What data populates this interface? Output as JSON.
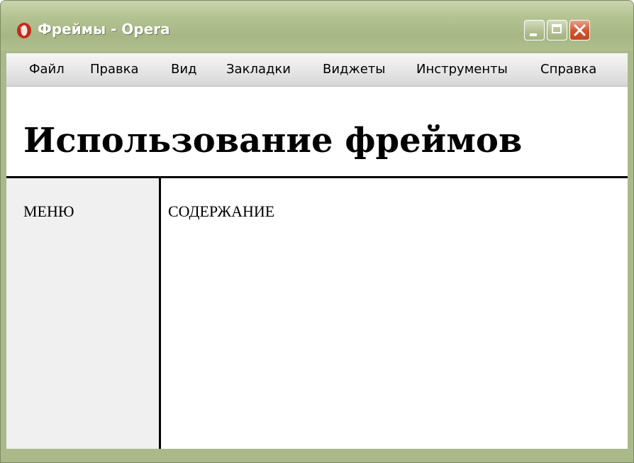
{
  "window": {
    "title": "Фреймы - Opera",
    "app_icon": "opera-icon",
    "controls": {
      "minimize_icon": "minimize-icon",
      "maximize_icon": "maximize-icon",
      "close_icon": "close-icon"
    }
  },
  "menubar": {
    "items": [
      {
        "label": "Файл"
      },
      {
        "label": "Правка"
      },
      {
        "label": "Вид"
      },
      {
        "label": "Закладки"
      },
      {
        "label": "Виджеты"
      },
      {
        "label": "Инструменты"
      },
      {
        "label": "Справка"
      }
    ]
  },
  "page": {
    "title": "Использование фреймов",
    "menu_frame_text": "МЕНЮ",
    "content_frame_text": "СОДЕРЖАНИЕ"
  },
  "colors": {
    "titlebar": "#a9b98a",
    "close_button": "#d3542f",
    "menu_frame_bg": "#f0f0f0"
  }
}
